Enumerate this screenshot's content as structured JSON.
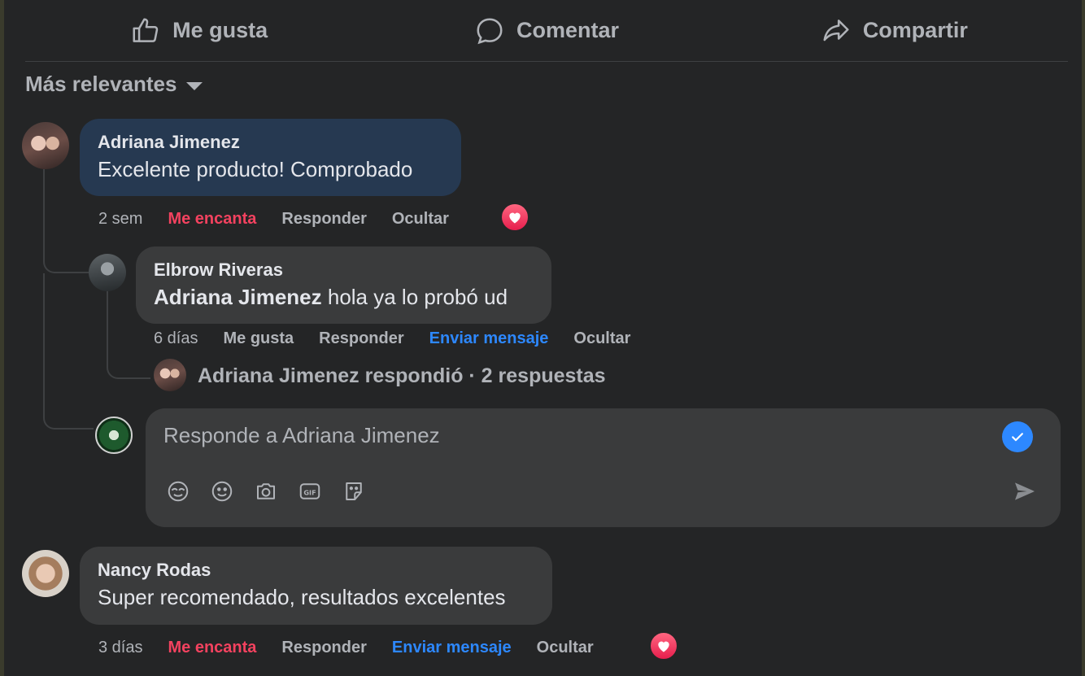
{
  "actions": {
    "like": "Me gusta",
    "comment": "Comentar",
    "share": "Compartir"
  },
  "sort": {
    "label": "Más relevantes"
  },
  "comments": [
    {
      "author": "Adriana Jimenez",
      "text": "Excelente producto! Comprobado",
      "time": "2 sem",
      "reaction": "Me encanta",
      "reply": "Responder",
      "hide": "Ocultar"
    },
    {
      "author": "Nancy Rodas",
      "text": "Super recomendado, resultados excelentes",
      "time": "3 días",
      "reaction": "Me encanta",
      "reply": "Responder",
      "message": "Enviar mensaje",
      "hide": "Ocultar"
    }
  ],
  "reply": {
    "author": "Elbrow Riveras",
    "mention": "Adriana Jimenez",
    "text": " hola ya lo probó ud",
    "time": "6 días",
    "like": "Me gusta",
    "reply": "Responder",
    "message": "Enviar mensaje",
    "hide": "Ocultar"
  },
  "replies_summary": "Adriana Jimenez respondió · 2 respuestas",
  "composer": {
    "placeholder": "Responde a Adriana Jimenez"
  },
  "colors": {
    "highlight_bubble": "#263951",
    "bubble": "#3a3b3c",
    "love": "#f3425f",
    "link": "#2d88ff"
  }
}
